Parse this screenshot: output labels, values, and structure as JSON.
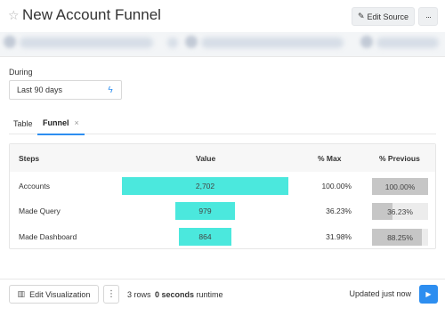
{
  "header": {
    "title": "New Account Funnel",
    "edit_source_label": "Edit Source",
    "more_label": "···"
  },
  "filter": {
    "label": "During",
    "value": "Last 90 days"
  },
  "tabs": [
    {
      "label": "Table"
    },
    {
      "label": "Funnel",
      "close": "×"
    }
  ],
  "funnel": {
    "columns": [
      "Steps",
      "Value",
      "% Max",
      "% Previous"
    ],
    "rows": [
      {
        "step": "Accounts",
        "value": "2,702",
        "raw": 2702,
        "pct_max": "100.00%",
        "pct_prev": "100.00%",
        "prev_fraction": 1.0
      },
      {
        "step": "Made Query",
        "value": "979",
        "raw": 979,
        "pct_max": "36.23%",
        "pct_prev": "36.23%",
        "prev_fraction": 0.3623
      },
      {
        "step": "Made Dashboard",
        "value": "864",
        "raw": 864,
        "pct_max": "31.98%",
        "pct_prev": "88.25%",
        "prev_fraction": 0.8825
      }
    ],
    "bar_color": "#4be8dd"
  },
  "footer": {
    "edit_visualization_label": "Edit Visualization",
    "kebab_label": "⋮",
    "rows_label": "3 rows",
    "runtime_value": "0 seconds",
    "runtime_suffix": " runtime",
    "updated_label": "Updated just now"
  },
  "colors": {
    "accent": "#2d8ef0"
  }
}
